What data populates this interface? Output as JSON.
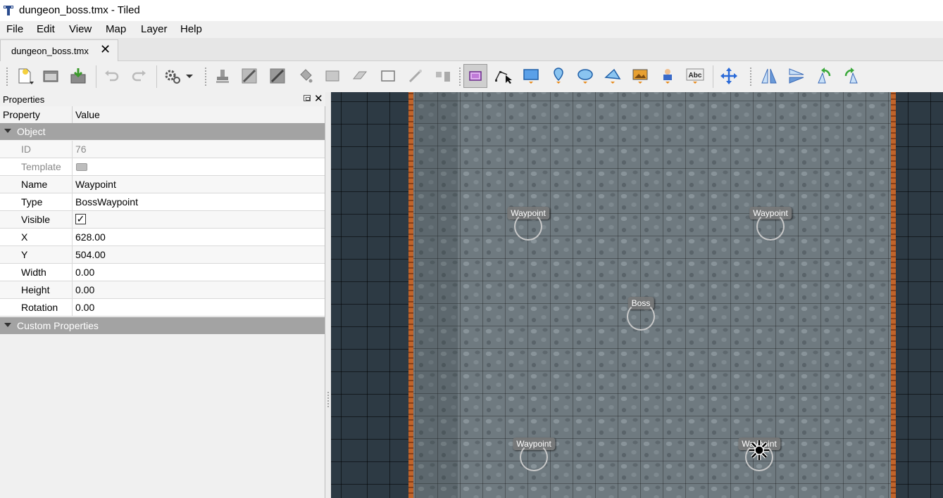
{
  "window": {
    "title": "dungeon_boss.tmx - Tiled"
  },
  "menu": [
    "File",
    "Edit",
    "View",
    "Map",
    "Layer",
    "Help"
  ],
  "tabs": [
    {
      "label": "dungeon_boss.tmx",
      "close": "✕"
    }
  ],
  "toolbar": {
    "buttons": [
      "new-map-icon",
      "open-icon",
      "save-icon",
      "undo-icon",
      "redo-icon",
      "command-icon",
      "stamp-brush-icon",
      "terrain-brush-icon",
      "wang-brush-icon",
      "bucket-fill-icon",
      "shape-fill-icon",
      "eraser-icon",
      "rectangle-select-icon",
      "magic-wand-icon",
      "select-same-tile-icon",
      "select-objects-icon",
      "edit-polygons-icon",
      "insert-rectangle-icon",
      "insert-point-icon",
      "insert-ellipse-icon",
      "insert-polygon-icon",
      "insert-tile-icon",
      "insert-template-icon",
      "insert-text-icon",
      "move-icon",
      "flip-horizontal-icon",
      "flip-vertical-icon",
      "rotate-left-icon",
      "rotate-right-icon"
    ],
    "text_tool_label": "Abc",
    "active_tool": "select-objects-icon"
  },
  "properties_panel": {
    "title": "Properties",
    "close": "✕",
    "header": {
      "property": "Property",
      "value": "Value"
    },
    "object_group": "Object",
    "rows": [
      {
        "key": "ID",
        "value": "76"
      },
      {
        "key": "Template",
        "value": ""
      },
      {
        "key": "Name",
        "value": "Waypoint"
      },
      {
        "key": "Type",
        "value": "BossWaypoint"
      },
      {
        "key": "Visible",
        "value": "✓"
      },
      {
        "key": "X",
        "value": "628.00"
      },
      {
        "key": "Y",
        "value": "504.00"
      },
      {
        "key": "Width",
        "value": "0.00"
      },
      {
        "key": "Height",
        "value": "0.00"
      },
      {
        "key": "Rotation",
        "value": "0.00"
      }
    ],
    "custom_group": "Custom Properties"
  },
  "map_objects": [
    {
      "name": "Waypoint"
    },
    {
      "name": "Waypoint"
    },
    {
      "name": "Boss"
    },
    {
      "name": "Waypoint"
    },
    {
      "name": "Waypoint"
    }
  ],
  "colors": {
    "wall": "#c0642b",
    "canvas_bg": "#2d3a44",
    "floor": "#6f7a80",
    "group_header": "#a3a3a3"
  }
}
